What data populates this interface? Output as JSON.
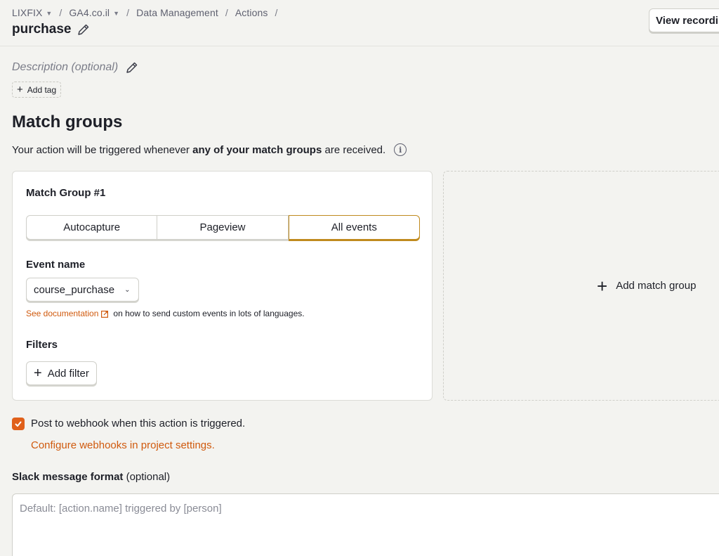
{
  "breadcrumb": {
    "org": "LIXFIX",
    "project": "GA4.co.il",
    "section": "Data Management",
    "page": "Actions"
  },
  "header": {
    "title": "purchase",
    "view_recordings_label": "View recordi"
  },
  "description_placeholder": "Description (optional)",
  "add_tag_label": "Add tag",
  "match_groups": {
    "title": "Match groups",
    "desc_prefix": "Your action will be triggered whenever ",
    "desc_bold": "any of your match groups",
    "desc_suffix": " are received."
  },
  "match_group": {
    "title": "Match Group #1",
    "tabs": [
      "Autocapture",
      "Pageview",
      "All events"
    ],
    "active_tab": "All events",
    "event_name_label": "Event name",
    "event_name_value": "course_purchase",
    "doc_link": "See documentation",
    "doc_suffix": " on how to send custom events in lots of languages.",
    "filters_label": "Filters",
    "add_filter_label": "Add filter"
  },
  "add_match_group_label": "Add match group",
  "webhook": {
    "checked": true,
    "label": "Post to webhook when this action is triggered.",
    "configure_link": "Configure webhooks in project settings."
  },
  "slack": {
    "label_bold": "Slack message format",
    "label_suffix": " (optional)",
    "placeholder": "Default: [action.name] triggered by [person]"
  },
  "colors": {
    "accent": "#e0601a",
    "link": "#d05a0e",
    "active_tab_border": "#c08a1e"
  }
}
